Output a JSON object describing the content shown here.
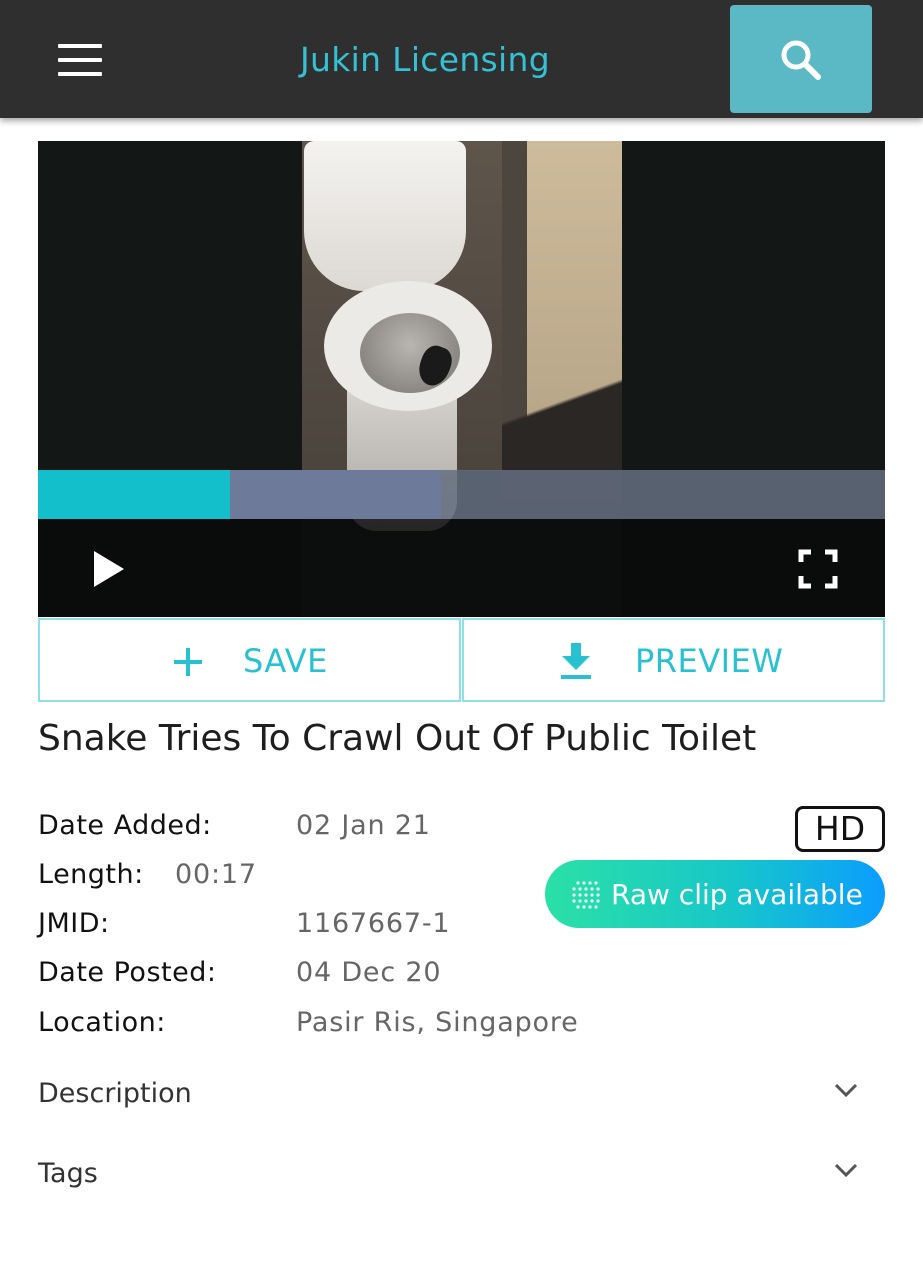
{
  "header": {
    "brand": "Jukin Licensing"
  },
  "video": {
    "progress": 0.227,
    "buffered": 0.476
  },
  "actions": {
    "save_label": "SAVE",
    "preview_label": "PREVIEW"
  },
  "clip": {
    "title": "Snake Tries To Crawl Out Of Public Toilet",
    "meta": {
      "date_added_label": "Date Added:",
      "date_added": "02 Jan 21",
      "length_label": "Length:",
      "length": "00:17",
      "jmid_label": "JMID:",
      "jmid": "1167667-1",
      "date_posted_label": "Date Posted:",
      "date_posted": "04 Dec 20",
      "location_label": "Location:",
      "location": "Pasir Ris, Singapore"
    },
    "hd_badge": "HD",
    "raw_clip_label": "Raw clip available"
  },
  "accordion": {
    "description": "Description",
    "tags": "Tags"
  },
  "colors": {
    "accent": "#28c1cf",
    "header_bg": "#2f2f2f",
    "search_bg": "#5bb9c6",
    "progress": "#14bfcc"
  }
}
